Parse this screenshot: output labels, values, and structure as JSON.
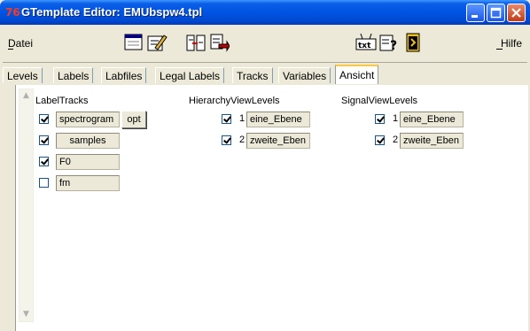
{
  "window": {
    "icon_glyph": "76",
    "title": "GTemplate Editor: EMUbspw4.tpl"
  },
  "menu": {
    "file": "Datei",
    "help": "Hilfe"
  },
  "toolbar": {
    "icons": [
      "window-icon",
      "edit-icon",
      "split-icon",
      "export-icon",
      "text-icon",
      "help-icon",
      "exit-icon"
    ]
  },
  "tabs": [
    "Levels",
    "Labels",
    "Labfiles",
    "Legal Labels",
    "Tracks",
    "Variables",
    "Ansicht"
  ],
  "active_tab": "Ansicht",
  "label_tracks": {
    "title": "LabelTracks",
    "items": [
      {
        "checked": true,
        "name": "spectrogram",
        "has_opt": true,
        "opt_label": "opt"
      },
      {
        "checked": true,
        "name": "samples"
      },
      {
        "checked": true,
        "name": "F0"
      },
      {
        "checked": false,
        "name": "fm"
      }
    ]
  },
  "hierarchy_view_levels": {
    "title": "HierarchyViewLevels",
    "items": [
      {
        "checked": true,
        "number": "1",
        "name": "eine_Ebene"
      },
      {
        "checked": true,
        "number": "2",
        "name": "zweite_Eben"
      }
    ]
  },
  "signal_view_levels": {
    "title": "SignalViewLevels",
    "items": [
      {
        "checked": true,
        "number": "1",
        "name": "eine_Ebene"
      },
      {
        "checked": true,
        "number": "2",
        "name": "zweite_Eben"
      }
    ]
  },
  "colors": {
    "titlebar": "#0054e3",
    "face": "#ece9d8",
    "active_tab_accent": "#ffc83c"
  }
}
